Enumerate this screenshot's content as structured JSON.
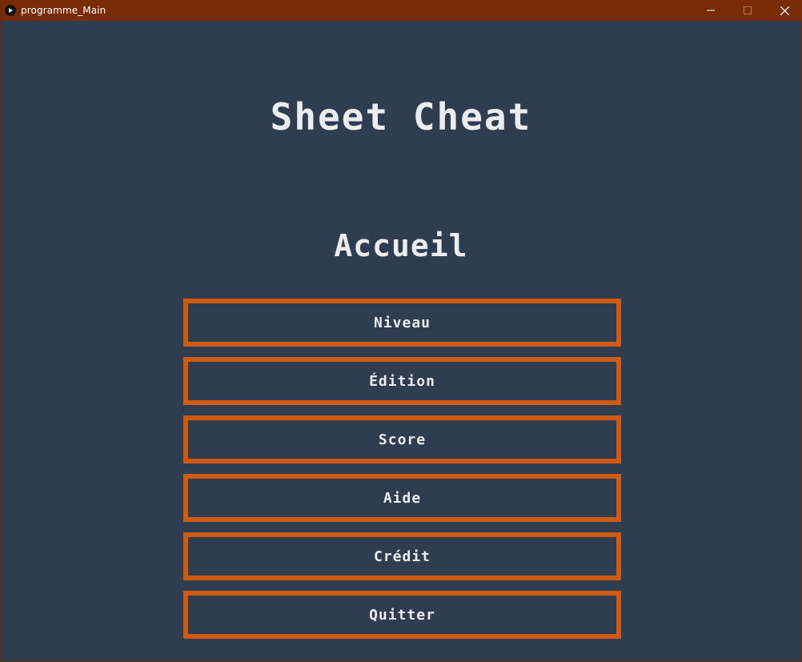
{
  "window": {
    "title": "programme_Main",
    "controls": {
      "minimize_icon": "minimize-icon",
      "maximize_icon": "maximize-icon",
      "close_icon": "close-icon"
    }
  },
  "app": {
    "title": "Sheet Cheat",
    "screen_title": "Accueil"
  },
  "menu": {
    "items": [
      {
        "label": "Niveau"
      },
      {
        "label": "Édition"
      },
      {
        "label": "Score"
      },
      {
        "label": "Aide"
      },
      {
        "label": "Crédit"
      },
      {
        "label": "Quitter"
      }
    ]
  },
  "colors": {
    "titlebar": "#782b05",
    "background": "#2e3d4f",
    "button_border": "#d05a10",
    "text": "#ecedf0"
  }
}
